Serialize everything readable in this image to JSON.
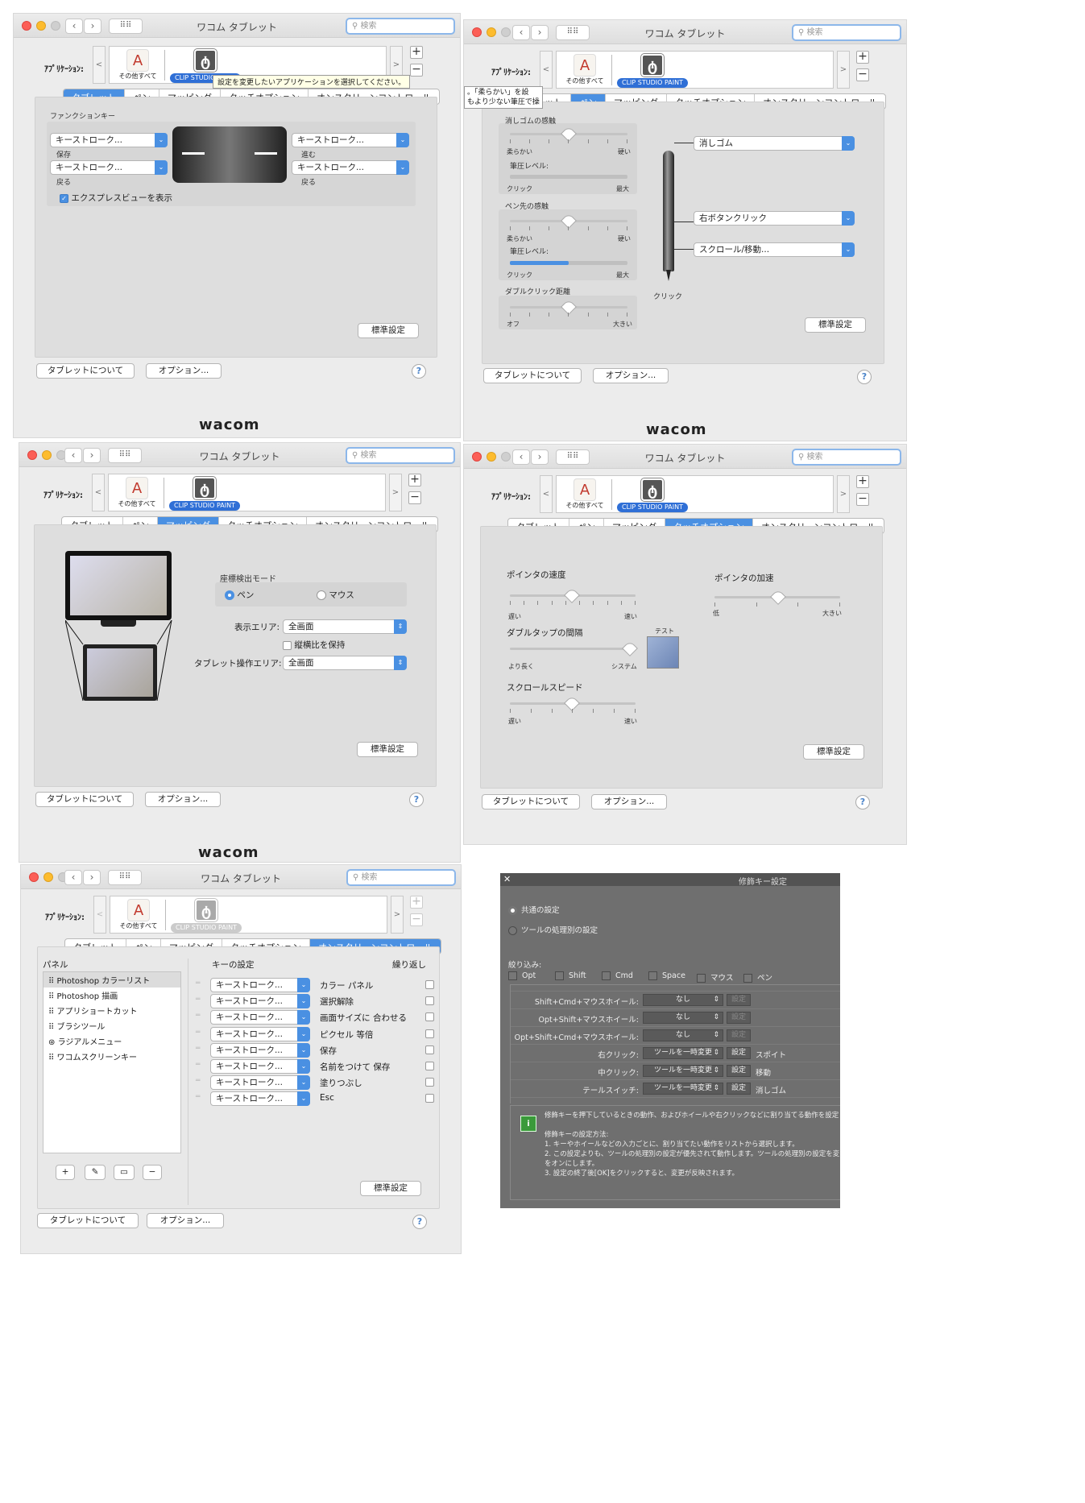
{
  "common": {
    "window_title": "ワコム タブレット",
    "search_placeholder": "検索",
    "app_label": "ｱﾌﾟﾘｹｰｼｮﾝ:",
    "app_all": "その他すべて",
    "app_csp": "CLIP STUDIO PAINT",
    "tabs": [
      "タブレット",
      "ペン",
      "マッピング",
      "タッチオプション",
      "オンスクリーンコントロール"
    ],
    "about_button": "タブレットについて",
    "options_button": "オプション...",
    "default_button": "標準設定",
    "help": "?",
    "brand": "wacom",
    "prev": "<",
    "next": ">",
    "plus": "+",
    "minus": "−"
  },
  "win1": {
    "tooltip": "設定を変更したいアプリケーションを選択してください。",
    "group_title": "ファンクションキー",
    "keys": [
      {
        "value": "キーストローク...",
        "label": "保存"
      },
      {
        "value": "キーストローク...",
        "label": "戻る"
      },
      {
        "value": "キーストローク...",
        "label": "進む"
      },
      {
        "value": "キーストローク...",
        "label": "戻る"
      }
    ],
    "express_view": "エクスプレスビューを表示"
  },
  "win2": {
    "tooltip_line1": "。「柔らかい」を設",
    "tooltip_line2": "もより少ない筆圧で操",
    "eraser_feel": "消しゴムの感触",
    "soft": "柔らかい",
    "hard": "硬い",
    "pressure_level": "筆圧レベル:",
    "click": "クリック",
    "max": "最大",
    "tip_feel": "ペン先の感触",
    "double_click": "ダブルクリック距離",
    "off": "オフ",
    "large": "大きい",
    "eraser_popup": "消しゴム",
    "upper_button_popup": "右ボタンクリック",
    "lower_button_popup": "スクロール/移動...",
    "tip_label": "クリック",
    "pressure_fill": 0.5
  },
  "win3": {
    "coord_mode": "座標検出モード",
    "pen": "ペン",
    "mouse": "マウス",
    "display_area_label": "表示エリア:",
    "display_area_value": "全画面",
    "keep_ratio": "縦横比を保持",
    "tablet_area_label": "タブレット操作エリア:",
    "tablet_area_value": "全画面"
  },
  "win4": {
    "pointer_speed": "ポインタの速度",
    "slow": "遅い",
    "fast": "速い",
    "pointer_accel": "ポインタの加速",
    "low": "低",
    "high": "大きい",
    "double_tap": "ダブルタップの間隔",
    "longer": "より長く",
    "system": "システム",
    "test": "テスト",
    "scroll_speed": "スクロールスピード"
  },
  "win5": {
    "panel_header": "パネル",
    "key_header": "キーの設定",
    "repeat_header": "繰り返し",
    "panels": [
      "Photoshop カラーリスト",
      "Photoshop 描画",
      "アプリショートカット",
      "ブラシツール",
      "ラジアルメニュー",
      "ワコムスクリーンキー"
    ],
    "key_value": "キーストローク...",
    "actions": [
      "カラー パネル",
      "選択解除",
      "画面サイズに 合わせる",
      "ピクセル 等倍",
      "保存",
      "名前をつけて 保存",
      "塗りつぶし",
      "Esc"
    ],
    "panel_buttons": [
      "+",
      "✎",
      "▭",
      "−"
    ]
  },
  "dialog": {
    "close": "✕",
    "title": "修飾キー設定",
    "common_setting": "共通の設定",
    "per_tool_setting": "ツールの処理別の設定",
    "filter": "絞り込み:",
    "filters": [
      "Opt",
      "Shift",
      "Cmd",
      "Space",
      "マウス",
      "ペン"
    ],
    "rows": [
      {
        "label": "Shift+Cmd+マウスホイール:",
        "value": "なし",
        "btn": "設定",
        "extra": ""
      },
      {
        "label": "Opt+Shift+マウスホイール:",
        "value": "なし",
        "btn": "設定",
        "extra": ""
      },
      {
        "label": "Opt+Shift+Cmd+マウスホイール:",
        "value": "なし",
        "btn": "設定",
        "extra": ""
      },
      {
        "label": "右クリック:",
        "value": "ツールを一時変更",
        "btn": "設定",
        "extra": "スポイト"
      },
      {
        "label": "中クリック:",
        "value": "ツールを一時変更",
        "btn": "設定",
        "extra": "移動"
      },
      {
        "label": "テールスイッチ:",
        "value": "ツールを一時変更",
        "btn": "設定",
        "extra": "消しゴム"
      }
    ],
    "info_icon": "i",
    "info_line1": "修飾キーを押下しているときの動作、およびホイールや右クリックなどに割り当てる動作を設定",
    "info_line2": "修飾キーの設定方法:",
    "info_line3": "1. キーやホイールなどの入力ごとに、割り当てたい動作をリストから選択します。",
    "info_line4": "2. この設定よりも、ツールの処理別の設定が優先されて動作します。ツールの処理別の設定を変",
    "info_line5": "をオンにします。",
    "info_line6": "3. 設定の終了後[OK]をクリックすると、変更が反映されます。"
  }
}
